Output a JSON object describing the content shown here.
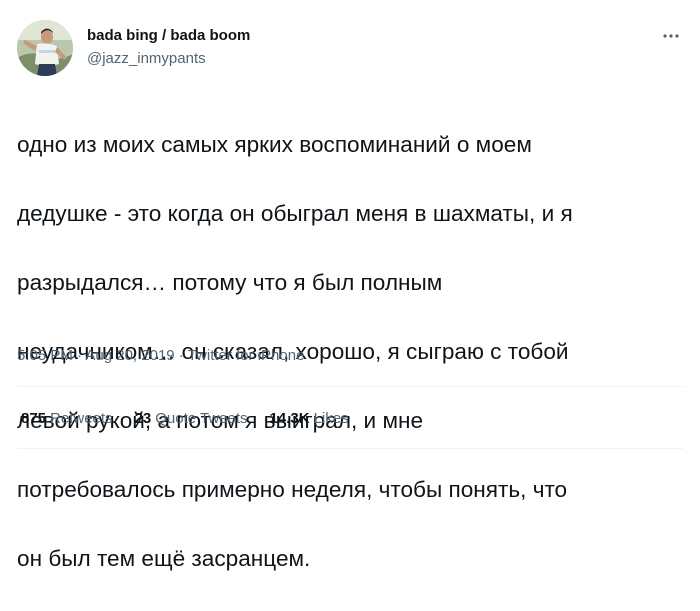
{
  "author": {
    "display_name": "bada bing / bada boom",
    "handle": "@jazz_inmypants"
  },
  "tweet": {
    "lines": [
      "одно из моих самых ярких воспоминаний о моем",
      "дедушке - это когда он обыграл меня в шахматы, и я",
      "разрыдался… потому что я был полным",
      "неудачником… он сказал, хорошо, я сыграю с тобой",
      "левой рукой, а потом я выиграл, и мне",
      "потребовалось примерно неделя, чтобы понять, что",
      "он был тем ещё засранцем."
    ]
  },
  "meta": {
    "time": "5:05 PM",
    "separator": " · ",
    "date": "Aug 20, 2019",
    "source": "Twitter for iPhone"
  },
  "stats": {
    "retweets_count": "875",
    "retweets_label": "Retweets",
    "quotes_count": "23",
    "quotes_label": "Quote Tweets",
    "likes_count": "14.3K",
    "likes_label": "Likes"
  },
  "icons": {
    "more": "more-horizontal-icon"
  },
  "colors": {
    "text": "#0f1419",
    "secondary": "#536471",
    "divider": "#eff3f4"
  }
}
